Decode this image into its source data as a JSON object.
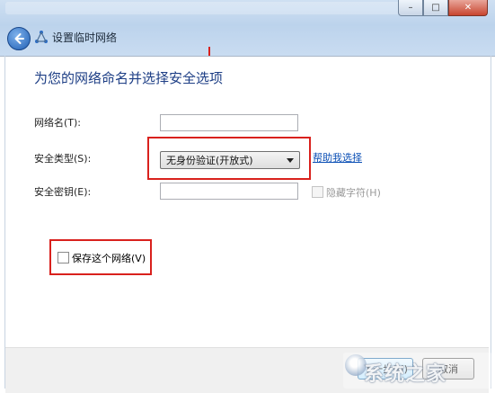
{
  "window": {
    "title": "设置临时网络",
    "minimize_label": "–",
    "maximize_label": "□",
    "close_label": "✕"
  },
  "icons": {
    "back": "back-arrow-icon",
    "network": "network-icon"
  },
  "page": {
    "heading": "为您的网络命名并选择安全选项"
  },
  "form": {
    "network_name": {
      "label": "网络名(T):",
      "value": ""
    },
    "security_type": {
      "label": "安全类型(S):",
      "selected": "无身份验证(开放式)"
    },
    "help_link": "帮助我选择",
    "security_key": {
      "label": "安全密钥(E):",
      "value": ""
    },
    "hide_chars": {
      "label": "隐藏字符(H)",
      "checked": false,
      "disabled": true
    },
    "save_network": {
      "label": "保存这个网络(V)",
      "checked": false
    }
  },
  "buttons": {
    "next": "下一步(N)",
    "cancel": "取消"
  },
  "watermark": {
    "text": "系统之家"
  },
  "colors": {
    "highlight_red": "#d9211d",
    "heading_blue": "#1d3e85",
    "link_blue": "#0b4fb5"
  }
}
